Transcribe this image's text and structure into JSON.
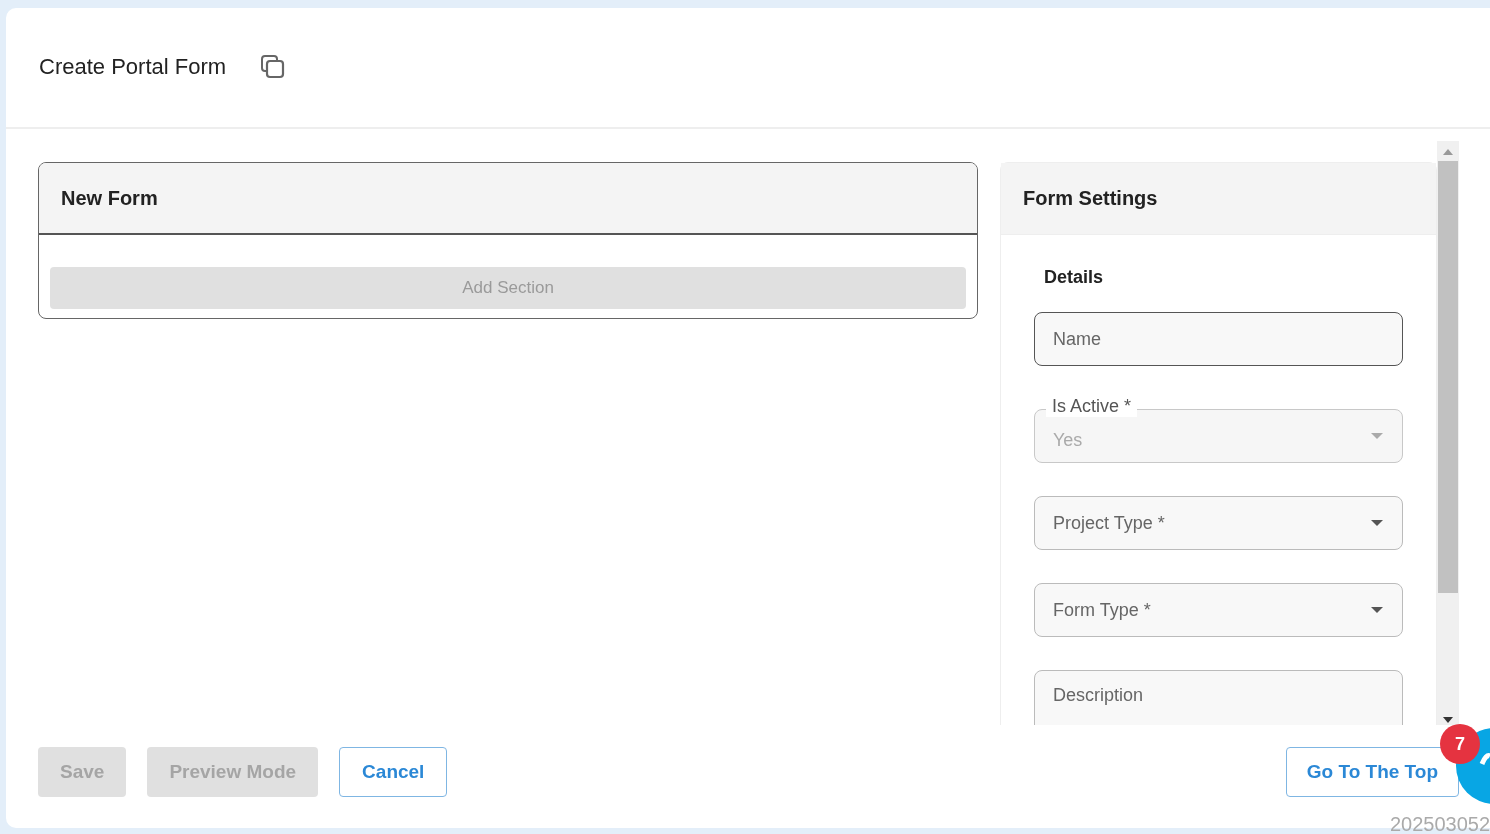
{
  "page": {
    "title": "Create Portal Form"
  },
  "form_panel": {
    "title": "New Form",
    "add_button": {
      "label": "Add Section",
      "disabled": true
    }
  },
  "settings_panel": {
    "title": "Form Settings",
    "section": "Details",
    "fields": [
      {
        "kind": "input",
        "placeholder": "Name",
        "focused": true
      },
      {
        "kind": "select",
        "label": "Is Active *",
        "value": "Yes",
        "focused": false,
        "disabled": true
      },
      {
        "kind": "select",
        "placeholder": "Project Type *",
        "focused": false,
        "disabled": false
      },
      {
        "kind": "select",
        "placeholder": "Form Type *",
        "focused": false,
        "disabled": false
      },
      {
        "kind": "textarea",
        "placeholder": "Description",
        "focused": false
      }
    ]
  },
  "footer": {
    "buttons": [
      {
        "label": "Save",
        "disabled": true,
        "kind": "filled"
      },
      {
        "label": "Preview Mode",
        "disabled": true,
        "kind": "filled"
      },
      {
        "label": "Cancel",
        "disabled": false,
        "kind": "outlined"
      }
    ],
    "top_button": "Go To The Top",
    "notification_count": "7",
    "timestamp": "202503052"
  }
}
